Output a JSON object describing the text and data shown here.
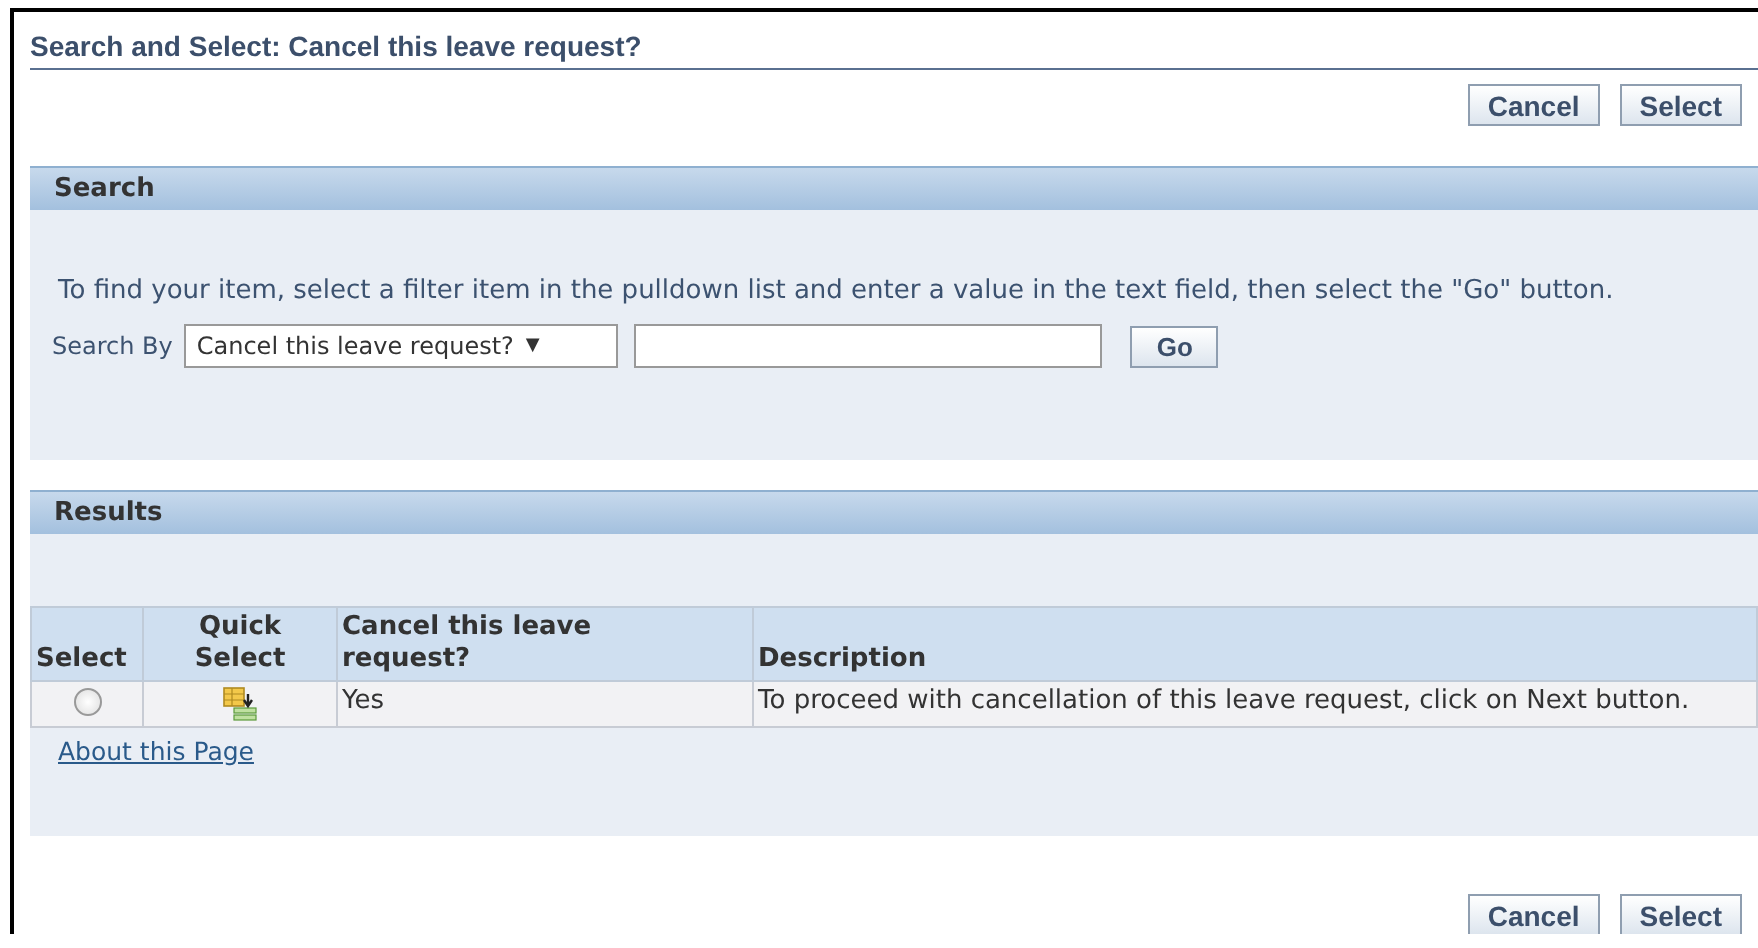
{
  "title": "Search and Select: Cancel this leave request?",
  "top_buttons": [
    "Cancel",
    "Select"
  ],
  "search": {
    "header": "Search",
    "instructions": "To find your item, select a filter item in the pulldown list and enter a value in the text field, then select the \"Go\" button.",
    "search_by_label": "Search By",
    "filter_value": "Cancel this leave request?",
    "dropdown_arrow": "▼",
    "go_button": "Go"
  },
  "results": {
    "header": "Results",
    "columns": [
      "Select",
      "Quick Select",
      "Cancel this leave request?",
      "Description"
    ],
    "rows": [
      {
        "selected": false,
        "value": "Yes",
        "description": "To proceed with cancellation of this leave request, click on Next button."
      }
    ],
    "about_link": "About this Page"
  },
  "bottom_buttons": [
    "Cancel",
    "Select"
  ]
}
